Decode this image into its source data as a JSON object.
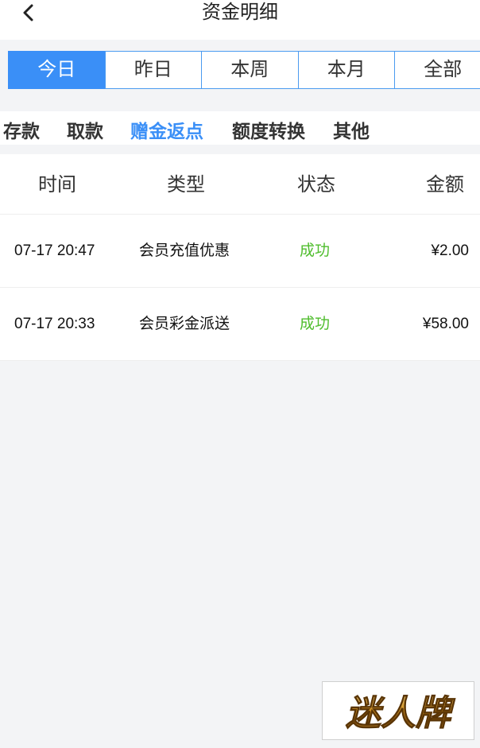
{
  "header": {
    "title": "资金明细"
  },
  "period_tabs": [
    "今日",
    "昨日",
    "本周",
    "本月",
    "全部"
  ],
  "category_tabs": [
    "存款",
    "取款",
    "赠金返点",
    "额度转换",
    "其他"
  ],
  "table": {
    "headers": {
      "time": "时间",
      "type": "类型",
      "status": "状态",
      "amount": "金额"
    },
    "rows": [
      {
        "time": "07-17 20:47",
        "type": "会员充值优惠",
        "status": "成功",
        "amount": "¥2.00"
      },
      {
        "time": "07-17 20:33",
        "type": "会员彩金派送",
        "status": "成功",
        "amount": "¥58.00"
      }
    ]
  },
  "logo": {
    "text": "迷人牌"
  },
  "colors": {
    "accent": "#3a8ff7",
    "success": "#4fbd2d",
    "background": "#f3f4f6"
  }
}
